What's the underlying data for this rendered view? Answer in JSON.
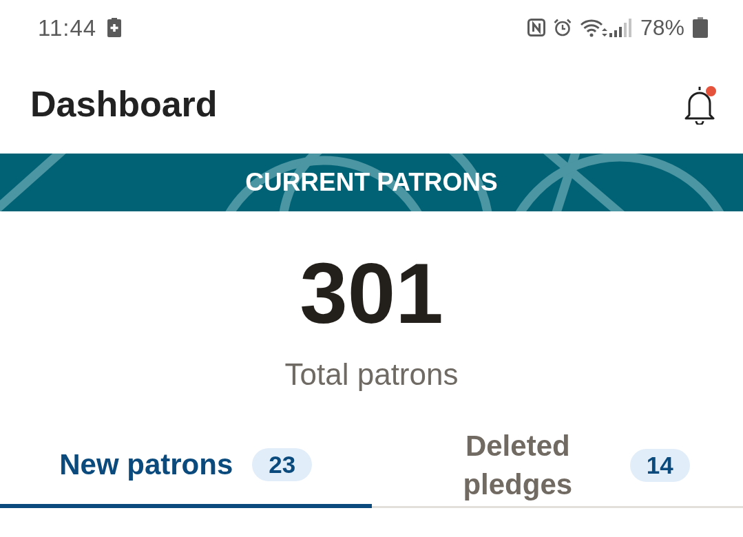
{
  "status_bar": {
    "time": "11:44",
    "battery_percent": "78%"
  },
  "header": {
    "title": "Dashboard",
    "notifications_unread": true
  },
  "banner": {
    "title": "CURRENT PATRONS"
  },
  "summary": {
    "value": "301",
    "label": "Total patrons"
  },
  "tabs": [
    {
      "label": "New patrons",
      "count": "23",
      "selected": true
    },
    {
      "label": "Deleted pledges",
      "count": "14",
      "selected": false
    }
  ]
}
